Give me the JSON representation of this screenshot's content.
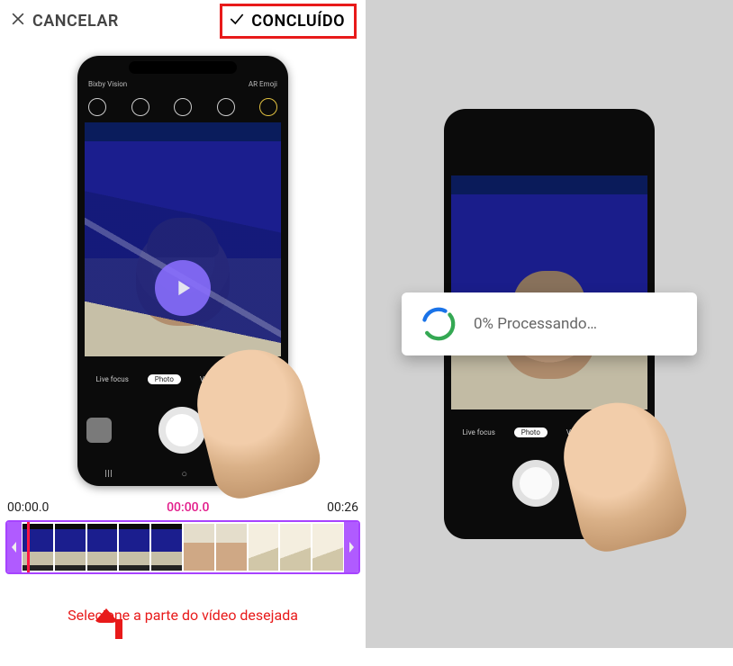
{
  "editor": {
    "cancel_label": "CANCELAR",
    "done_label": "CONCLUÍDO",
    "time_start": "00:00.0",
    "time_playhead": "00:00.0",
    "time_end": "00:26",
    "annotation": "Selecione a parte do vídeo desejada",
    "camera_modes": {
      "live_focus": "Live focus",
      "photo": "Photo",
      "video": "Video",
      "live_focus2": "Live focus"
    },
    "status_left": "Bixby Vision",
    "status_right": "AR Emoji"
  },
  "processing": {
    "percent": "0%",
    "label": "Processando…"
  }
}
